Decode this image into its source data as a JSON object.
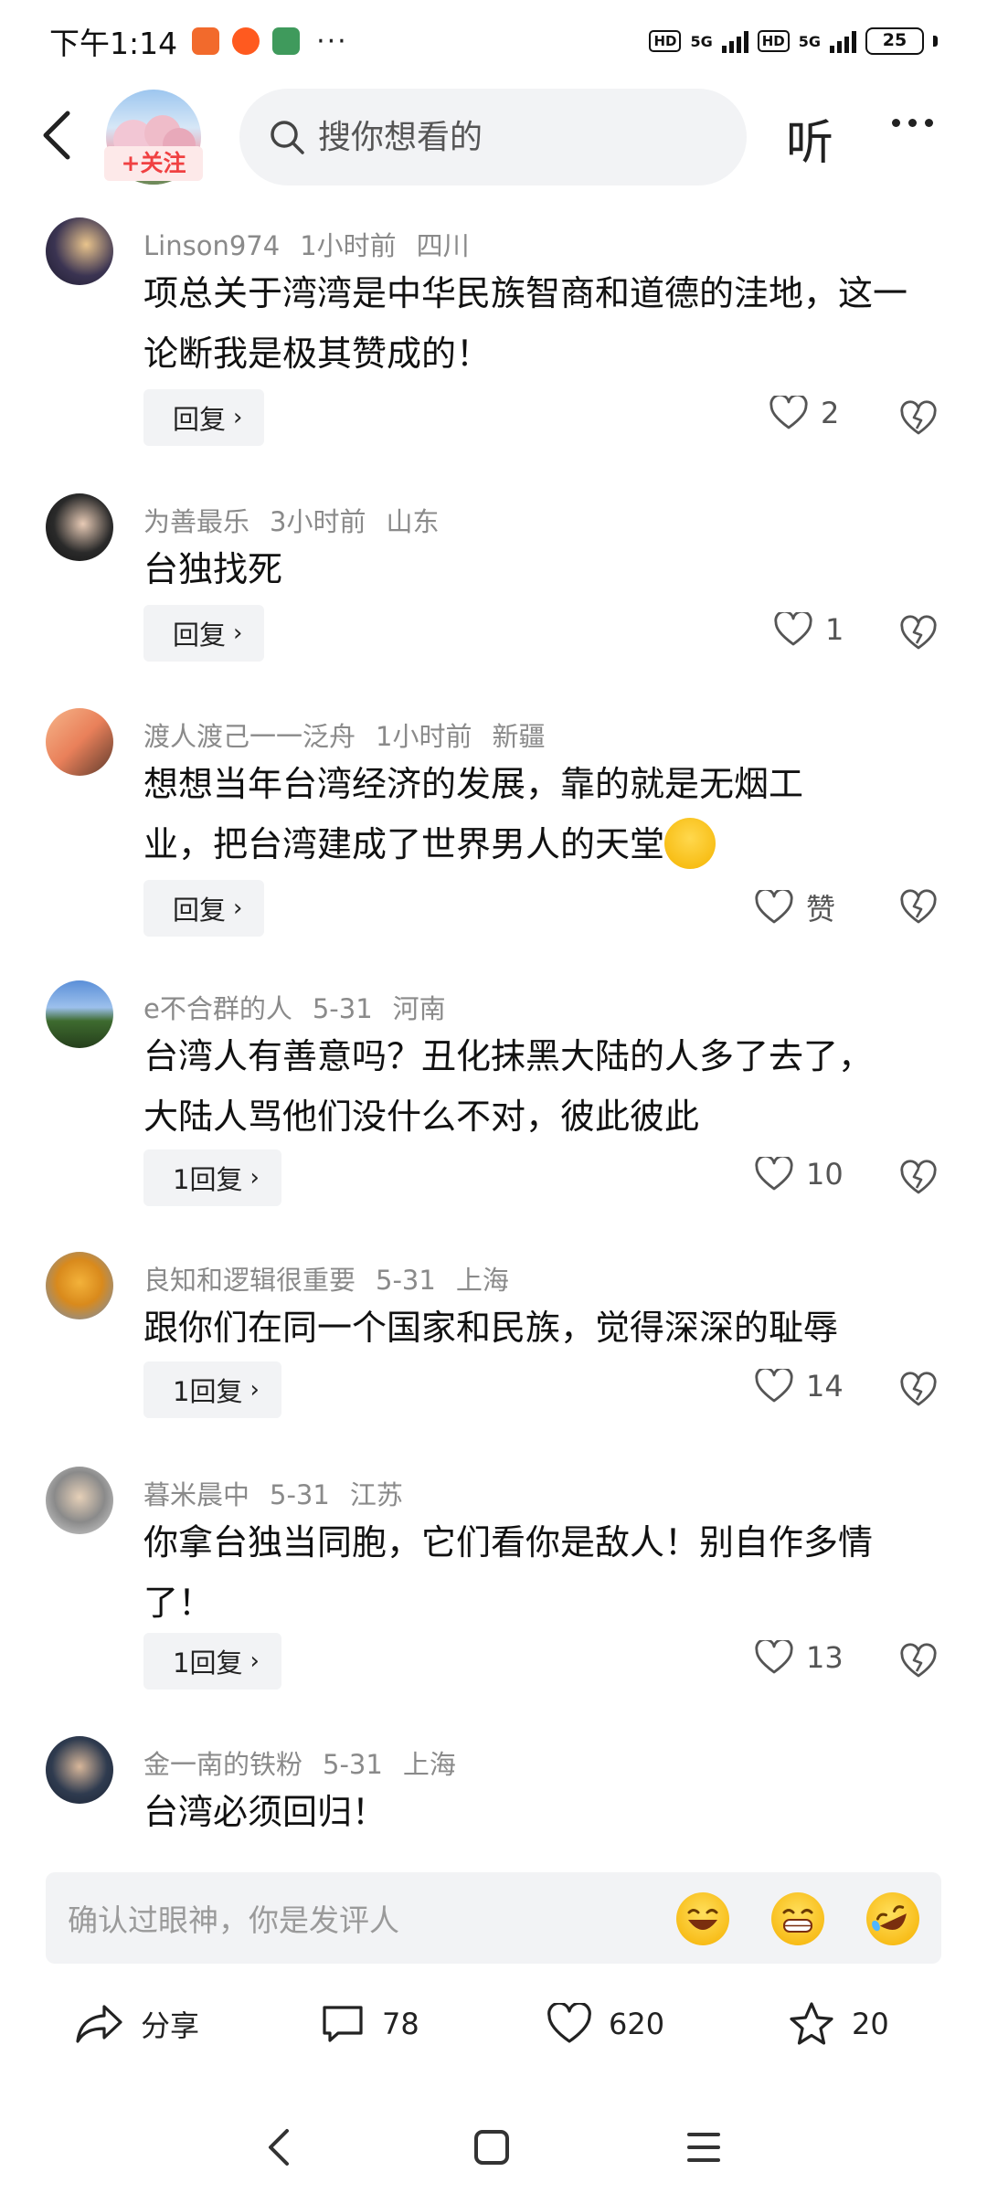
{
  "status_bar": {
    "time": "下午1:14",
    "more": "···",
    "network_1": "5G",
    "network_2": "5G",
    "hd": "HD",
    "battery": "25",
    "battery_level": 0.25
  },
  "nav": {
    "follow_label": "+关注",
    "search_placeholder": "搜你想看的",
    "listen_label": "听"
  },
  "comments": [
    {
      "user": "Linson974",
      "time": "1小时前",
      "region": "四川",
      "text": "项总关于湾湾是中华民族智商和道德的洼地，这一论断我是极其赞成的！",
      "reply_label": "回复",
      "likes": "2"
    },
    {
      "user": "为善最乐",
      "time": "3小时前",
      "region": "山东",
      "text": "台独找死",
      "reply_label": "回复",
      "likes": "1"
    },
    {
      "user": "渡人渡己一一泛舟",
      "time": "1小时前",
      "region": "新疆",
      "text": "想想当年台湾经济的发展，靠的就是无烟工业，把台湾建成了世界男人的天堂",
      "reply_label": "回复",
      "likes": "赞"
    },
    {
      "user": "e不合群的人",
      "time": "5-31",
      "region": "河南",
      "text": "台湾人有善意吗？丑化抹黑大陆的人多了去了，大陆人骂他们没什么不对，彼此彼此",
      "reply_label": "1回复",
      "likes": "10"
    },
    {
      "user": "良知和逻辑很重要",
      "time": "5-31",
      "region": "上海",
      "text": "跟你们在同一个国家和民族，觉得深深的耻辱",
      "reply_label": "1回复",
      "likes": "14"
    },
    {
      "user": "暮米晨中",
      "time": "5-31",
      "region": "江苏",
      "text": "你拿台独当同胞，它们看你是敌人！别自作多情了！",
      "reply_label": "1回复",
      "likes": "13"
    },
    {
      "user": "金一南的铁粉",
      "time": "5-31",
      "region": "上海",
      "text": "台湾必须回归！"
    }
  ],
  "input_bar": {
    "placeholder": "确认过眼神，你是发评人"
  },
  "actions": {
    "share_label": "分享",
    "comments_count": "78",
    "likes_count": "620",
    "favorites_count": "20"
  },
  "colors": {
    "accent_red": "#f04142",
    "follow_bg": "#fde9e9",
    "input_bg": "#f2f3f5",
    "meta_gray": "#8a8a8a"
  },
  "icons": [
    "back-arrow-icon",
    "search-icon",
    "more-dots-icon",
    "heart-icon",
    "broken-heart-icon",
    "chevron-right-icon",
    "share-icon",
    "comment-bubble-icon",
    "star-icon",
    "laugh-emoji-icon",
    "grin-emoji-icon",
    "rofl-emoji-icon",
    "system-back-icon",
    "system-home-icon",
    "system-menu-icon"
  ]
}
